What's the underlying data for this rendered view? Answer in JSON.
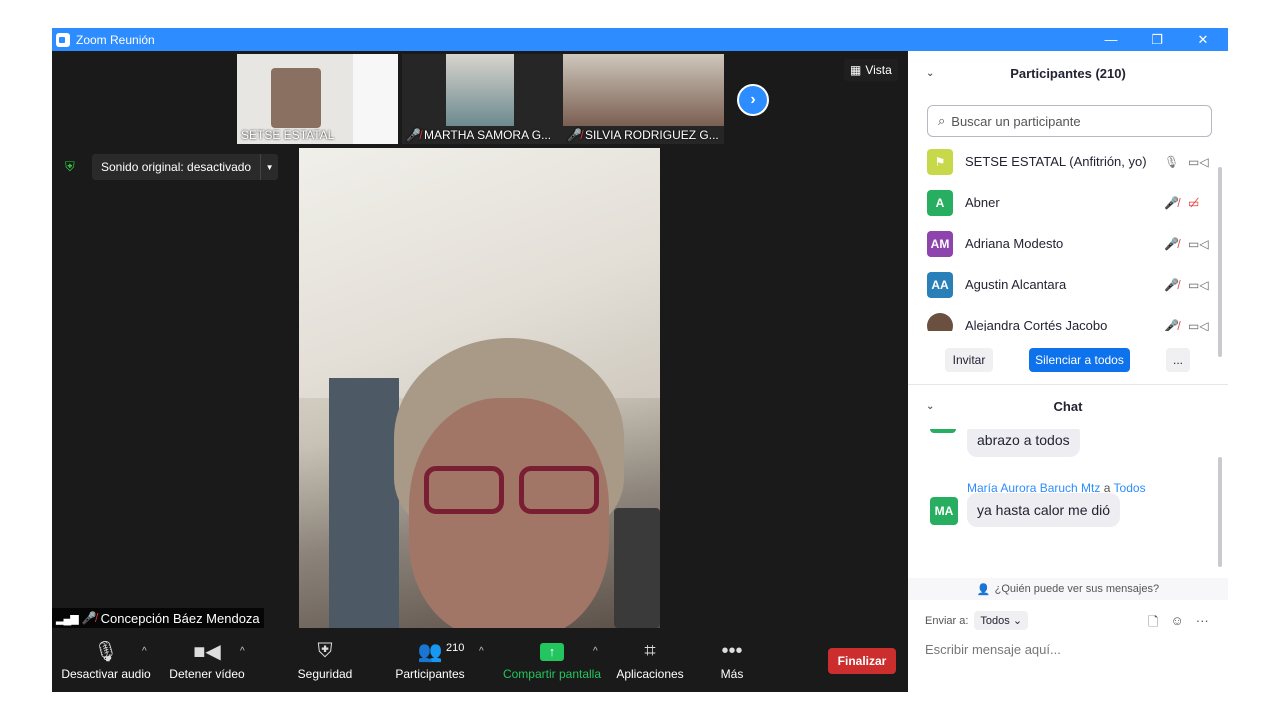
{
  "window": {
    "title": "Zoom Reunión",
    "controls": {
      "minimize": "—",
      "restore": "❐",
      "close": "✕"
    }
  },
  "gallery": {
    "thumbs": [
      {
        "name": "SETSE ESTATAL",
        "muted": false
      },
      {
        "name": "MARTHA SAMORA G...",
        "muted": true
      },
      {
        "name": "SILVIA RODRIGUEZ G...",
        "muted": true
      }
    ],
    "next_icon": "chevron-right-icon",
    "view_label": "Vista"
  },
  "audio_status": {
    "text": "Sonido original: desactivado"
  },
  "active_speaker": {
    "name": "Concepción Báez Mendoza"
  },
  "toolbar": {
    "mute": "Desactivar audio",
    "video": "Detener vídeo",
    "security": "Seguridad",
    "participants": "Participantes",
    "participants_count": "210",
    "share": "Compartir pantalla",
    "apps": "Aplicaciones",
    "more": "Más",
    "end": "Finalizar"
  },
  "participants_panel": {
    "title": "Participantes (210)",
    "search_placeholder": "Buscar un participante",
    "list": [
      {
        "initials": "",
        "name": "SETSE ESTATAL (Anfitrión, yo)",
        "color": "#c7d94a",
        "mic_muted": false,
        "cam_off": false
      },
      {
        "initials": "A",
        "name": "Abner",
        "color": "#27ae60",
        "mic_muted": true,
        "cam_off": true
      },
      {
        "initials": "AM",
        "name": "Adriana Modesto",
        "color": "#8e44ad",
        "mic_muted": true,
        "cam_off": false
      },
      {
        "initials": "AA",
        "name": "Agustin Alcantara",
        "color": "#2980b9",
        "mic_muted": true,
        "cam_off": false
      },
      {
        "initials": "",
        "name": "Alejandra Cortés Jacobo",
        "color": "#6b4f3f",
        "mic_muted": true,
        "cam_off": false
      }
    ],
    "invite": "Invitar",
    "mute_all": "Silenciar a todos",
    "more": "..."
  },
  "chat_panel": {
    "title": "Chat",
    "messages": [
      {
        "text": "abrazo a todos"
      },
      {
        "sender": "María Aurora Baruch Mtz",
        "to_word": "a",
        "recipient": "Todos",
        "initials": "MA",
        "text": "ya hasta calor me dió"
      }
    ],
    "who_can_see": "¿Quién puede ver sus mensajes?",
    "send_to_label": "Enviar a:",
    "send_to_value": "Todos",
    "input_placeholder": "Escribir mensaje aquí..."
  },
  "colors": {
    "accent": "#2d8cff",
    "end_button": "#cc2e2e",
    "share_green": "#22c55e",
    "muted_red": "#e5383b"
  }
}
